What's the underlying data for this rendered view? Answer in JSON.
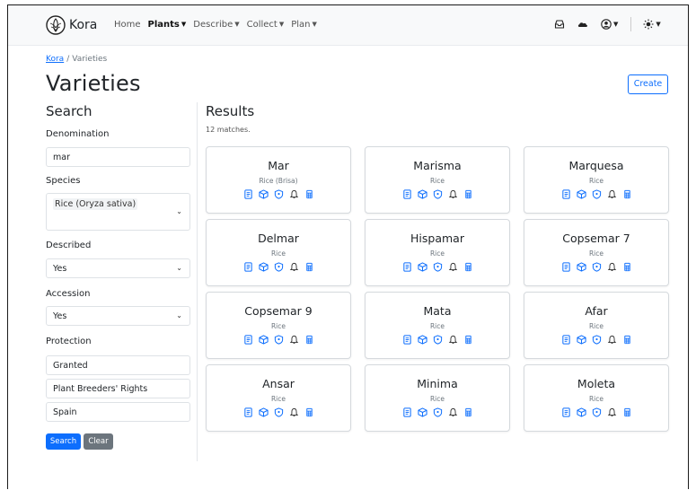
{
  "navbar": {
    "brand": "Kora",
    "links": [
      {
        "label": "Home",
        "caret": false,
        "active": false
      },
      {
        "label": "Plants",
        "caret": true,
        "active": true
      },
      {
        "label": "Describe",
        "caret": true,
        "active": false
      },
      {
        "label": "Collect",
        "caret": true,
        "active": false
      },
      {
        "label": "Plan",
        "caret": true,
        "active": false
      }
    ],
    "right_icons": [
      "inbox-icon",
      "cloud-icon",
      "user-icon",
      "sun-icon"
    ]
  },
  "breadcrumb": {
    "root": "Kora",
    "current": "Varieties"
  },
  "page": {
    "title": "Varieties",
    "create_label": "Create"
  },
  "search": {
    "heading": "Search",
    "denomination": {
      "label": "Denomination",
      "value": "mar"
    },
    "species": {
      "label": "Species",
      "value": "Rice (Oryza sativa)"
    },
    "described": {
      "label": "Described",
      "value": "Yes"
    },
    "accession": {
      "label": "Accession",
      "value": "Yes"
    },
    "protection": {
      "label": "Protection",
      "values": [
        "Granted",
        "Plant Breeders' Rights",
        "Spain"
      ]
    },
    "search_button": "Search",
    "clear_button": "Clear"
  },
  "results": {
    "heading": "Results",
    "count_text": "12 matches.",
    "items": [
      {
        "name": "Mar",
        "species": "Rice (Brisa)"
      },
      {
        "name": "Marisma",
        "species": "Rice"
      },
      {
        "name": "Marquesa",
        "species": "Rice"
      },
      {
        "name": "Delmar",
        "species": "Rice"
      },
      {
        "name": "Hispamar",
        "species": "Rice"
      },
      {
        "name": "Copsemar 7",
        "species": "Rice"
      },
      {
        "name": "Copsemar 9",
        "species": "Rice"
      },
      {
        "name": "Mata",
        "species": "Rice"
      },
      {
        "name": "Afar",
        "species": "Rice"
      },
      {
        "name": "Ansar",
        "species": "Rice"
      },
      {
        "name": "Minima",
        "species": "Rice"
      },
      {
        "name": "Moleta",
        "species": "Rice"
      }
    ],
    "item_icons": [
      "description-icon",
      "seed-box-icon",
      "shield-icon",
      "bell-icon",
      "calculator-icon"
    ]
  },
  "colors": {
    "primary": "#0d6efd",
    "secondary": "#6c757d",
    "navbar_bg": "#f8f9fa"
  }
}
